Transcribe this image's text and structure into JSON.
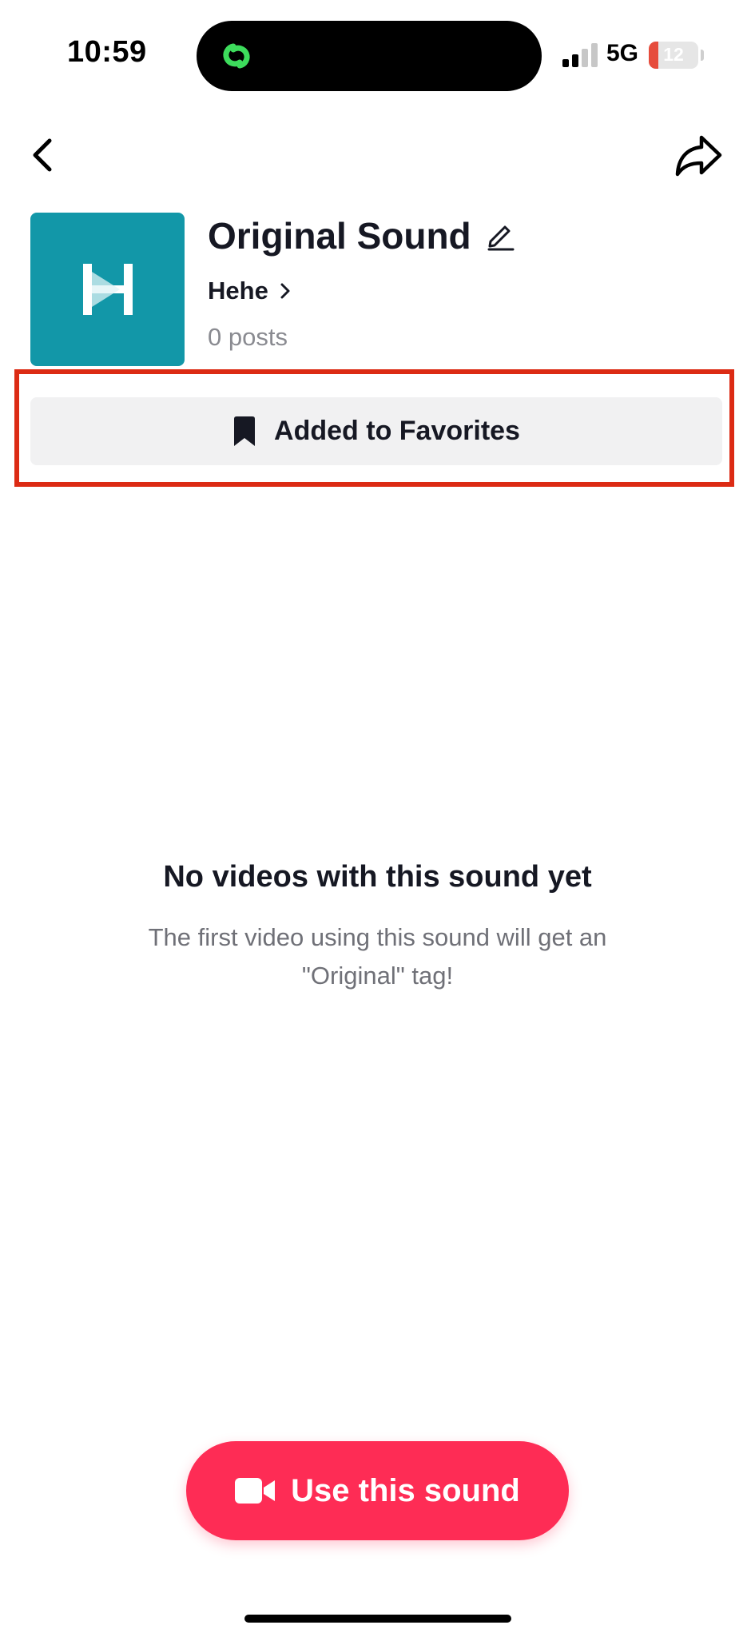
{
  "status_bar": {
    "time": "10:59",
    "network": "5G",
    "battery": "12",
    "battery_level_percent": 12
  },
  "sound": {
    "title": "Original Sound",
    "author": "Hehe",
    "post_count": "0 posts",
    "cover_color": "#1297a8"
  },
  "favorites": {
    "label": "Added to Favorites",
    "highlight_color": "#dc2b14"
  },
  "empty_state": {
    "title": "No videos with this sound yet",
    "text": "The first video using this sound will get an \"Original\" tag!"
  },
  "use_button": {
    "label": "Use this sound",
    "color": "#fe2c55"
  },
  "icons": {
    "island": "link-rings-icon",
    "back": "chevron-left-icon",
    "share": "share-arrow-icon",
    "edit": "pencil-icon",
    "author": "chevron-right-icon",
    "favorite": "bookmark-icon",
    "use": "video-camera-icon"
  }
}
